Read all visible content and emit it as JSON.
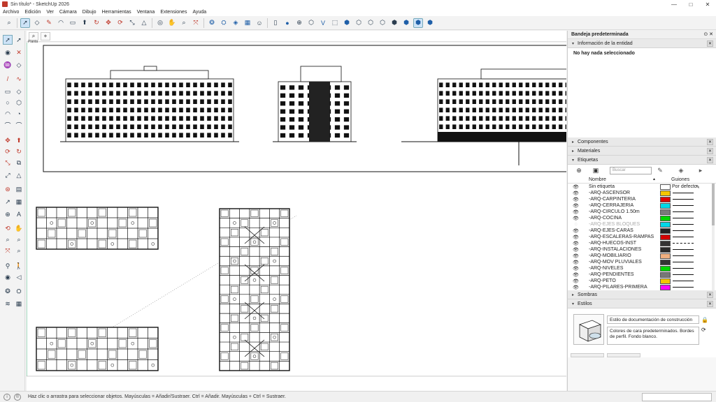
{
  "window": {
    "title": "Sin título* - SketchUp 2026"
  },
  "menu": [
    "Archivo",
    "Edición",
    "Ver",
    "Cámara",
    "Dibujo",
    "Herramientas",
    "Ventana",
    "Extensiones",
    "Ayuda"
  ],
  "scene": {
    "label": "Planta"
  },
  "status": {
    "text": "Haz clic o arrastra para seleccionar objetos. Mayúsculas = Añadir/Sustraer. Ctrl = Añadir. Mayúsculas + Ctrl = Sustraer."
  },
  "tray": {
    "title": "Bandeja predeterminada",
    "entity_info": {
      "title": "Información de la entidad",
      "empty_text": "No hay nada seleccionado"
    },
    "components_title": "Componentes",
    "materials_title": "Materiales",
    "tags": {
      "title": "Etiquetas",
      "search_placeholder": "Buscar",
      "col_name": "Nombre",
      "col_dashes": "Guiones",
      "default_dash": "Por defecto",
      "rows": [
        {
          "name": "Sin etiqueta",
          "color": "#ffffff",
          "visible": true
        },
        {
          "name": "-ARQ-ASCENSOR",
          "color": "#f5c400",
          "visible": true
        },
        {
          "name": "-ARQ-CARPINTERIA",
          "color": "#e00000",
          "visible": true
        },
        {
          "name": "-ARQ-CERRAJERIA",
          "color": "#00d8e8",
          "visible": true
        },
        {
          "name": "-ARQ-CIRCULO 1.50m",
          "color": "#7a7a7a",
          "visible": true
        },
        {
          "name": "-ARQ-COCINA",
          "color": "#00d400",
          "visible": true
        },
        {
          "name": "-ARQ-EJES BLOQUES",
          "color": "#00d8e8",
          "visible": false
        },
        {
          "name": "-ARQ-EJES-CARAS",
          "color": "#222222",
          "visible": true
        },
        {
          "name": "-ARQ-ESCALERAS-RAMPAS",
          "color": "#d40000",
          "visible": true
        },
        {
          "name": "-ARQ-HUECOS-INST",
          "color": "#333333",
          "visible": true,
          "dashed": true
        },
        {
          "name": "-ARQ-INSTALACIONES",
          "color": "#2a2a2a",
          "visible": true
        },
        {
          "name": "-ARQ-MOBILIARIO",
          "color": "#f0b080",
          "visible": true
        },
        {
          "name": "-ARQ-MOV PLUVIALES",
          "color": "#333333",
          "visible": true
        },
        {
          "name": "-ARQ-NIVELES",
          "color": "#00d400",
          "visible": true
        },
        {
          "name": "-ARQ-PENDIENTES",
          "color": "#777777",
          "visible": true
        },
        {
          "name": "-ARQ-PETO",
          "color": "#f5c400",
          "visible": true
        },
        {
          "name": "-ARQ-PILARES-PRIMERA",
          "color": "#ff00ff",
          "visible": true
        }
      ]
    },
    "shadows_title": "Sombras",
    "styles": {
      "title": "Estilos",
      "name": "Estilo de documentación de construcción",
      "description": "Colores de cara predeterminados. Bordes de perfil. Fondo blanco."
    }
  }
}
